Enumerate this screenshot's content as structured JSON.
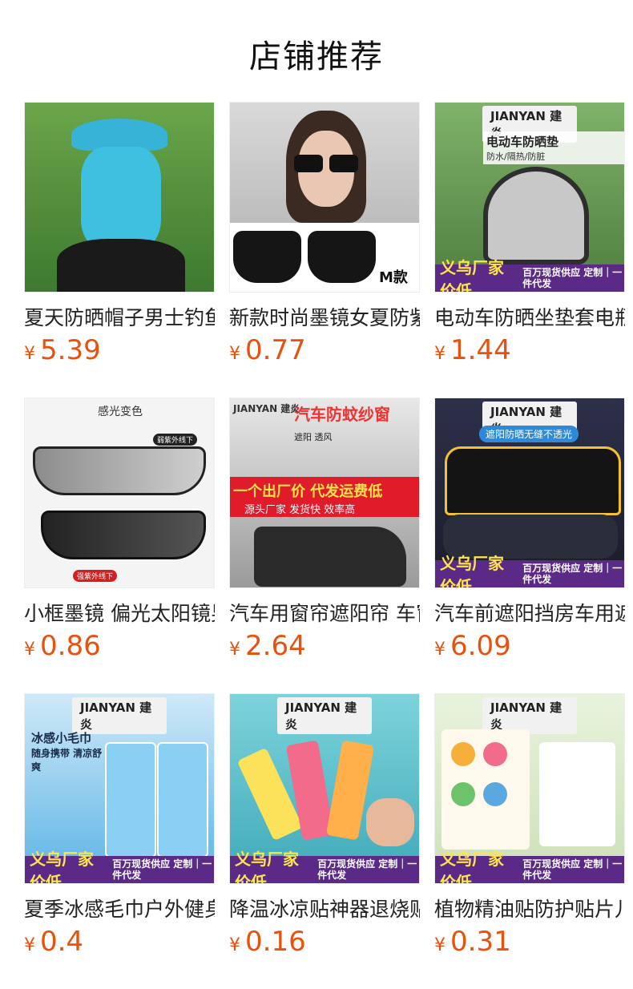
{
  "page_title": "店铺推荐",
  "currency": "¥",
  "products": [
    {
      "name": "夏天防晒帽子男士钓鱼面罩",
      "price": "5.39",
      "image_label": "",
      "bg": "#4e8e3c",
      "accent": "#34b6d3"
    },
    {
      "name": "新款时尚墨镜女夏防紫外线",
      "price": "0.77",
      "image_label": "M款",
      "bg": "#ececec",
      "accent": "#111111"
    },
    {
      "name": "电动车防晒坐垫套电瓶车",
      "price": "1.44",
      "image_label": "电动车防晒垫",
      "image_sub": "防水/隔热/防脏",
      "brand": "JIANYAN 建炎",
      "badge": "义乌厂家价低",
      "badge_sub": "百万现货供应 定制｜一件代发",
      "bg": "#6a9b55",
      "accent": "#c9c9c9"
    },
    {
      "name": "小框墨镜 偏光太阳镜男",
      "price": "0.86",
      "image_label": "感光变色",
      "image_tag1": "弱紫外线下",
      "image_tag2": "强紫外线下",
      "bg": "#f3f3f3",
      "accent": "#333333"
    },
    {
      "name": "汽车用窗帘遮阳帘 车窗",
      "price": "2.64",
      "brand": "JIANYAN 建炎",
      "image_label": "汽车防蚊纱窗",
      "image_sub": "遮阳 透风",
      "image_strip": "一个出厂价 代发运费低",
      "image_strip_sub": "源头厂家 发货快 效率高",
      "bg": "#d7d7d7",
      "accent": "#e01b2a"
    },
    {
      "name": "汽车前遮阳挡房车用遮",
      "price": "6.09",
      "brand": "JIANYAN 建炎",
      "image_label": "遮阳防晒无缝不透光",
      "badge": "义乌厂家价低",
      "badge_sub": "百万现货供应 定制｜一件代发",
      "bg": "#3b3f55",
      "accent": "#f2c230"
    },
    {
      "name": "夏季冰感毛巾户外健身",
      "price": "0.4",
      "brand": "JIANYAN 建炎",
      "image_label": "冰感小毛巾",
      "image_sub": "随身携带 清凉舒爽",
      "badge": "义乌厂家价低",
      "badge_sub": "百万现货供应 定制｜一件代发",
      "bg": "#5ab3e5",
      "accent": "#ffffff"
    },
    {
      "name": "降温冰凉贴神器退烧贴",
      "price": "0.16",
      "brand": "JIANYAN 建炎",
      "badge": "义乌厂家价低",
      "badge_sub": "百万现货供应 定制｜一件代发",
      "bg": "#58c1cf",
      "accent": "#f26b8a"
    },
    {
      "name": "植物精油贴防护贴片儿童",
      "price": "0.31",
      "brand": "JIANYAN 建炎",
      "badge": "义乌厂家价低",
      "badge_sub": "百万现货供应 定制｜一件代发",
      "bg": "#dbe9cf",
      "accent": "#f6b03a"
    }
  ]
}
